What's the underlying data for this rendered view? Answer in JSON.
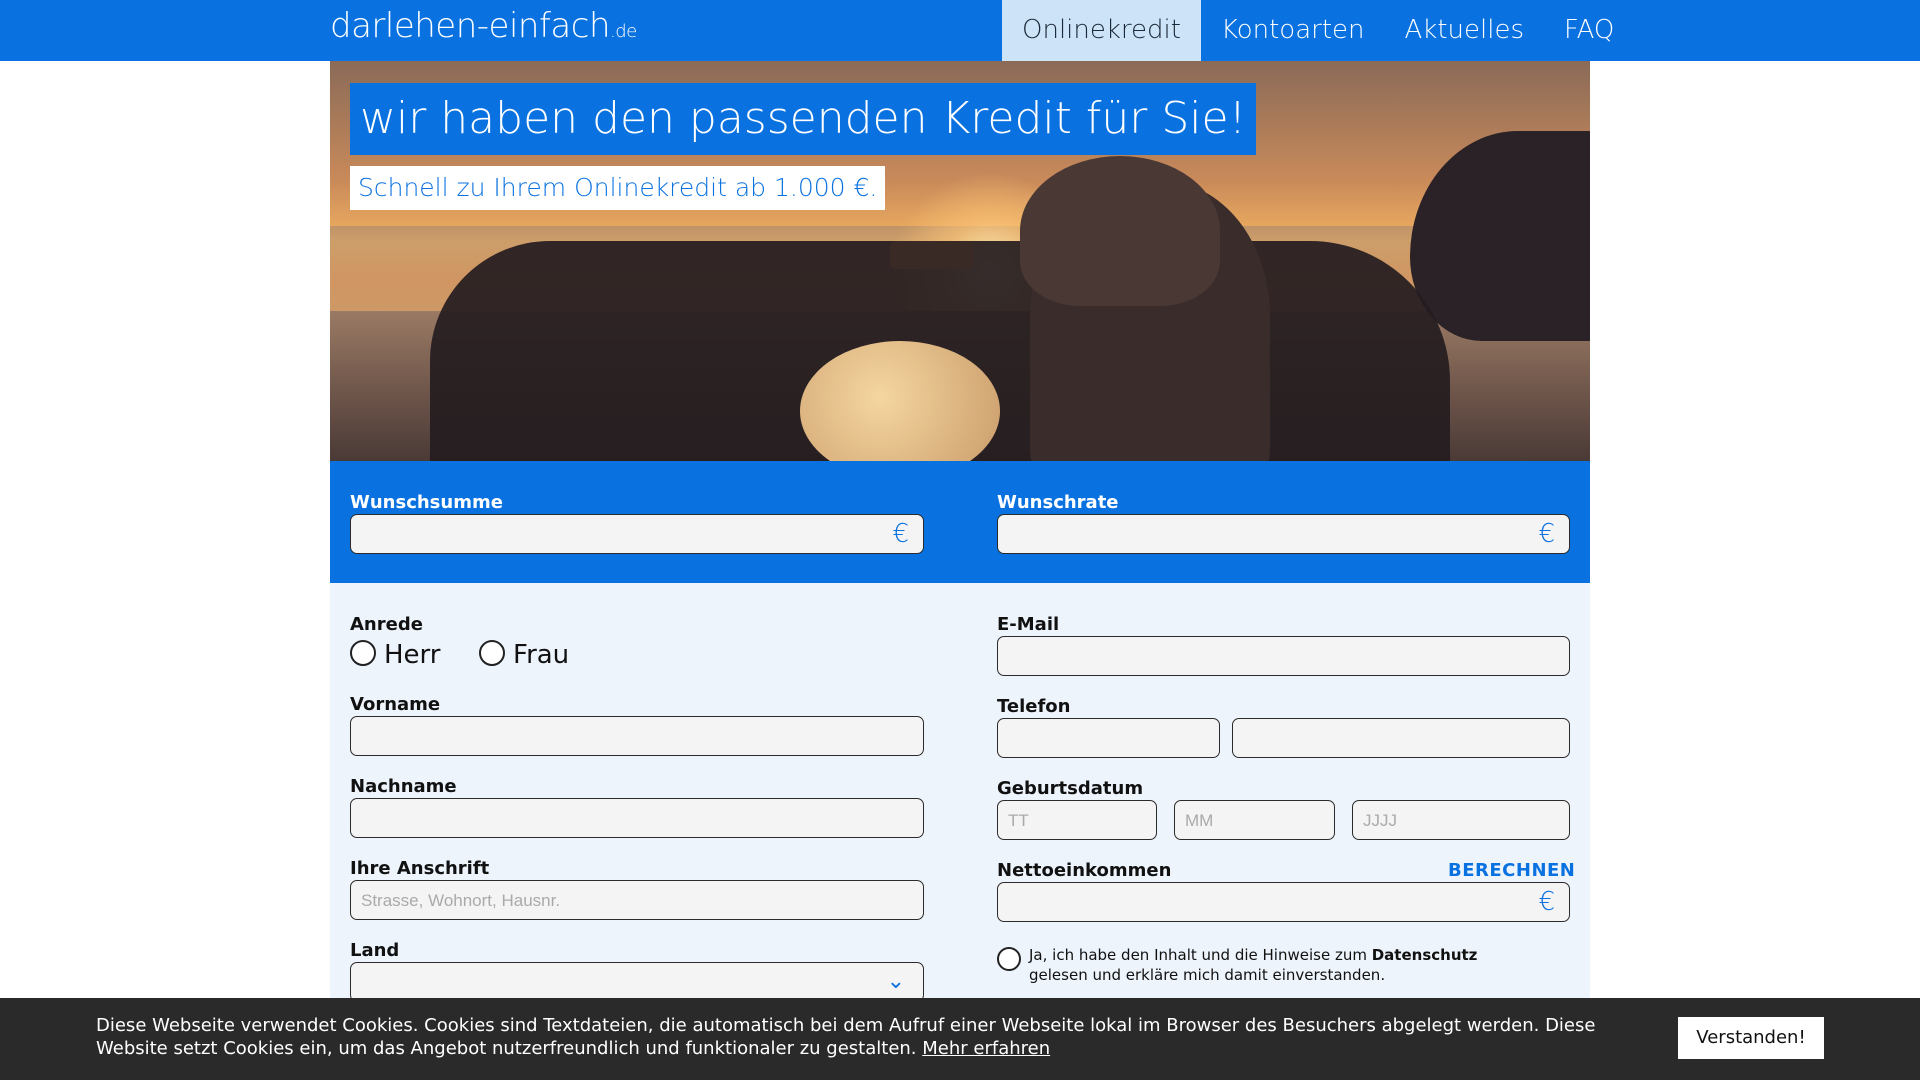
{
  "header": {
    "logo_main": "darlehen-einfach",
    "logo_tld": ".de",
    "nav": [
      {
        "label": "Onlinekredit",
        "active": true
      },
      {
        "label": "Kontoarten",
        "active": false
      },
      {
        "label": "Aktuelles",
        "active": false
      },
      {
        "label": "FAQ",
        "active": false
      }
    ]
  },
  "hero": {
    "title": "wir haben den passenden Kredit für Sie!",
    "subtitle": "Schnell zu Ihrem Onlinekredit ab 1.000 €."
  },
  "band": {
    "wunschsumme_label": "Wunschsumme",
    "wunschrate_label": "Wunschrate",
    "currency_symbol": "€"
  },
  "form": {
    "anrede_label": "Anrede",
    "anrede_options": [
      "Herr",
      "Frau"
    ],
    "vorname_label": "Vorname",
    "nachname_label": "Nachname",
    "anschrift_label": "Ihre Anschrift",
    "anschrift_placeholder": "Strasse, Wohnort, Hausnr.",
    "land_label": "Land",
    "email_label": "E-Mail",
    "telefon_label": "Telefon",
    "geburtsdatum_label": "Geburtsdatum",
    "geburtsdatum_placeholders": [
      "TT",
      "MM",
      "JJJJ"
    ],
    "nettoeinkommen_label": "Nettoeinkommen",
    "berechnen_label": "BERECHNEN",
    "consent_pre": "Ja, ich habe den Inhalt und die Hinweise zum ",
    "consent_bold": "Datenschutz",
    "consent_post": "gelesen und erkläre mich damit einverstanden.",
    "chevron_icon": "chevron-down-icon"
  },
  "cookie": {
    "text": "Diese Webseite verwendet Cookies. Cookies sind Textdateien, die automatisch bei dem Aufruf einer Webseite lokal im Browser des Besuchers abgelegt werden. Diese Website setzt Cookies ein, um das Angebot nutzerfreundlich und funktionaler zu gestalten. ",
    "link": "Mehr erfahren",
    "button": "Verstanden!"
  },
  "colors": {
    "brand_blue": "#0a72e0",
    "nav_active_bg": "#cde3f7",
    "form_bg": "#eef4fc",
    "cookie_bg": "#2a2a2a"
  }
}
